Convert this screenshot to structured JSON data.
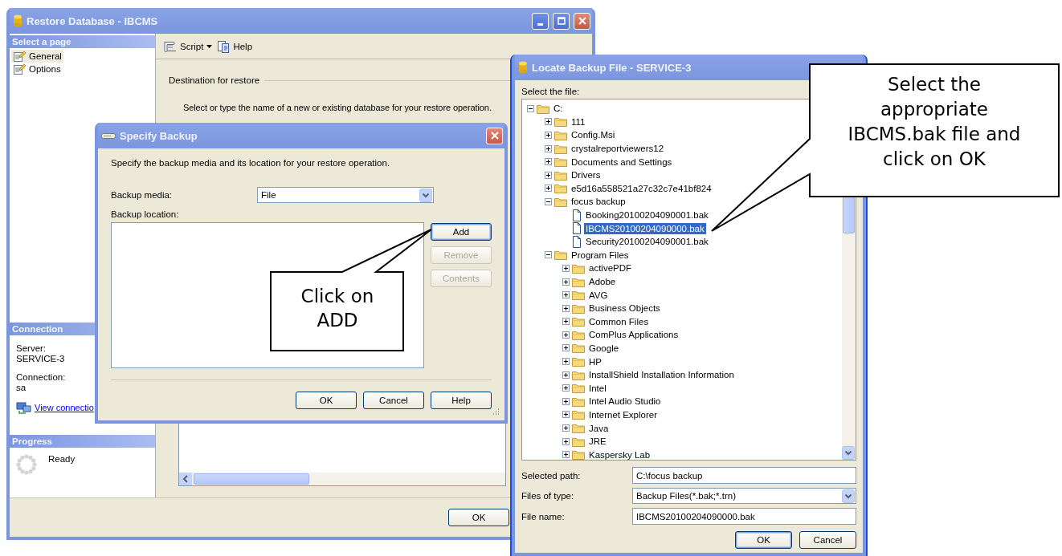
{
  "restore_window": {
    "title": "Restore Database - IBCMS",
    "sidebar": {
      "header": "Select a page",
      "items": [
        {
          "label": "General",
          "selected": true
        },
        {
          "label": "Options",
          "selected": false
        }
      ]
    },
    "toolbar": [
      {
        "label": "Script",
        "kind": "dropdown"
      },
      {
        "label": "Help",
        "kind": "button"
      }
    ],
    "destination": {
      "heading": "Destination for restore",
      "description": "Select or type the name of a new or existing database for your restore operation."
    },
    "connection": {
      "header": "Connection",
      "items": [
        {
          "label": "Server:",
          "value": "SERVICE-3"
        },
        {
          "label": "Connection:",
          "value": "sa"
        }
      ],
      "link": "View connectio"
    },
    "progress": {
      "header": "Progress",
      "status": "Ready"
    },
    "buttons": [
      {
        "label": "OK"
      }
    ]
  },
  "specify_backup": {
    "title": "Specify Backup",
    "description": "Specify the backup media and its location for your restore operation.",
    "backup_media": {
      "label": "Backup media:",
      "value": "File"
    },
    "backup_location": {
      "label": "Backup location:"
    },
    "side_buttons": [
      {
        "label": "Add",
        "disabled": false,
        "default": true
      },
      {
        "label": "Remove",
        "disabled": true,
        "default": false
      },
      {
        "label": "Contents",
        "disabled": true,
        "default": false
      }
    ],
    "buttons": [
      {
        "label": "OK"
      },
      {
        "label": "Cancel"
      },
      {
        "label": "Help"
      }
    ]
  },
  "locate_backup_file": {
    "title": "Locate Backup File - SERVICE-3",
    "prompt": "Select the file:",
    "tree": {
      "label": "C:",
      "kind": "folder",
      "expanded": true,
      "selected": false,
      "children": [
        {
          "label": "111",
          "kind": "folder",
          "expanded": false,
          "selected": false
        },
        {
          "label": "Config.Msi",
          "kind": "folder",
          "expanded": false,
          "selected": false
        },
        {
          "label": "crystalreportviewers12",
          "kind": "folder",
          "expanded": false,
          "selected": false
        },
        {
          "label": "Documents and Settings",
          "kind": "folder",
          "expanded": false,
          "selected": false
        },
        {
          "label": "Drivers",
          "kind": "folder",
          "expanded": false,
          "selected": false
        },
        {
          "label": "e5d16a558521a27c32c7e41bf824",
          "kind": "folder",
          "expanded": false,
          "selected": false
        },
        {
          "label": "focus backup",
          "kind": "folder",
          "expanded": true,
          "selected": false,
          "children": [
            {
              "label": "Booking20100204090001.bak",
              "kind": "file",
              "selected": false
            },
            {
              "label": "IBCMS20100204090000.bak",
              "kind": "file",
              "selected": true
            },
            {
              "label": "Security20100204090001.bak",
              "kind": "file",
              "selected": false
            }
          ]
        },
        {
          "label": "Program Files",
          "kind": "folder",
          "expanded": true,
          "selected": false,
          "children": [
            {
              "label": "activePDF",
              "kind": "folder",
              "expanded": false,
              "selected": false
            },
            {
              "label": "Adobe",
              "kind": "folder",
              "expanded": false,
              "selected": false
            },
            {
              "label": "AVG",
              "kind": "folder",
              "expanded": false,
              "selected": false
            },
            {
              "label": "Business Objects",
              "kind": "folder",
              "expanded": false,
              "selected": false
            },
            {
              "label": "Common Files",
              "kind": "folder",
              "expanded": false,
              "selected": false
            },
            {
              "label": "ComPlus Applications",
              "kind": "folder",
              "expanded": false,
              "selected": false
            },
            {
              "label": "Google",
              "kind": "folder",
              "expanded": false,
              "selected": false
            },
            {
              "label": "HP",
              "kind": "folder",
              "expanded": false,
              "selected": false
            },
            {
              "label": "InstallShield Installation Information",
              "kind": "folder",
              "expanded": false,
              "selected": false
            },
            {
              "label": "Intel",
              "kind": "folder",
              "expanded": false,
              "selected": false
            },
            {
              "label": "Intel Audio Studio",
              "kind": "folder",
              "expanded": false,
              "selected": false
            },
            {
              "label": "Internet Explorer",
              "kind": "folder",
              "expanded": false,
              "selected": false
            },
            {
              "label": "Java",
              "kind": "folder",
              "expanded": false,
              "selected": false
            },
            {
              "label": "JRE",
              "kind": "folder",
              "expanded": false,
              "selected": false
            },
            {
              "label": "Kaspersky Lab",
              "kind": "folder",
              "expanded": false,
              "selected": false
            }
          ]
        }
      ]
    },
    "fields": [
      {
        "label": "Selected path:",
        "kind": "text",
        "value": "C:\\focus backup"
      },
      {
        "label": "Files of type:",
        "kind": "combo",
        "value": "Backup Files(*.bak;*.trn)"
      },
      {
        "label": "File name:",
        "kind": "text",
        "value": "IBCMS20100204090000.bak"
      }
    ],
    "buttons": [
      {
        "label": "OK",
        "default": true
      },
      {
        "label": "Cancel",
        "default": false
      }
    ]
  },
  "callouts": [
    {
      "text": "Select the appropriate IBCMS.bak file and click on OK"
    },
    {
      "text": "Click on ADD"
    }
  ]
}
